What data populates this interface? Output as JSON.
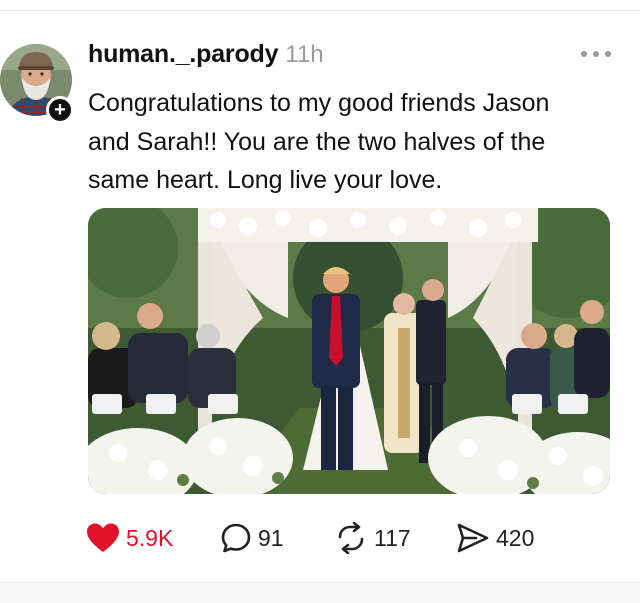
{
  "post": {
    "username": "human._.parody",
    "timestamp": "11h",
    "text_lines": [
      "Congratulations to my good friends Jason",
      "and Sarah!! You are the two halves of the",
      "same heart. Long live your love."
    ],
    "avatar_icon": "avatar-man-beard-cap",
    "follow_badge": "+"
  },
  "actions": {
    "likes": "5.9K",
    "comments": "91",
    "reposts": "117",
    "shares": "420"
  },
  "colors": {
    "like_red": "#e0112b",
    "text": "#111111",
    "muted": "#9a9a9a"
  },
  "icons": {
    "like": "heart-icon",
    "comment": "comment-icon",
    "repost": "repost-icon",
    "share": "send-icon",
    "menu": "more-dots-icon"
  }
}
